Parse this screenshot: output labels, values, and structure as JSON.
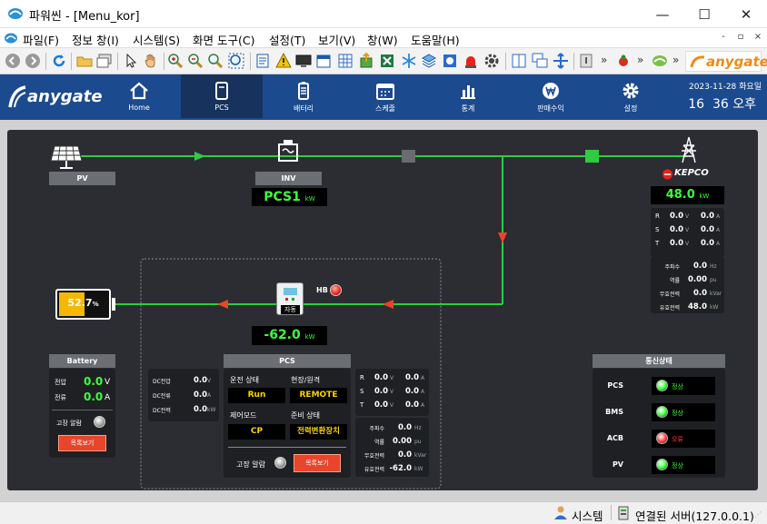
{
  "window": {
    "title": "파워씬 - [Menu_kor]",
    "minimize": "—",
    "maximize": "☐",
    "close": "✕"
  },
  "menubar": {
    "items": [
      "파일(F)",
      "정보 창(I)",
      "시스템(S)",
      "화면 도구(C)",
      "설정(T)",
      "보기(V)",
      "창(W)",
      "도움말(H)"
    ],
    "mdi": [
      "-",
      "▫",
      "×"
    ]
  },
  "toolbar": {
    "overflow": "»",
    "logo": "anygate"
  },
  "header": {
    "logo": "anygate",
    "tabs": [
      {
        "label": "Home",
        "icon": "home-icon"
      },
      {
        "label": "PCS",
        "icon": "phone-icon"
      },
      {
        "label": "배터리",
        "icon": "battery-icon"
      },
      {
        "label": "스케줄",
        "icon": "calendar-icon"
      },
      {
        "label": "통계",
        "icon": "bar-chart-icon"
      },
      {
        "label": "판매수익",
        "icon": "won-icon"
      },
      {
        "label": "설정",
        "icon": "gear-icon"
      }
    ],
    "active_tab": "PCS",
    "date": "2023-11-28 화요일",
    "time": "16  36 오후"
  },
  "diagram": {
    "pv_label": "PV",
    "inv_label": "INV",
    "inv_value": "PCS1",
    "inv_unit": "kW",
    "kepco_logo": "KEPCO",
    "grid_power": "48.0",
    "grid_unit": "kW",
    "battery_soc": "52.7",
    "battery_soc_unit": "%",
    "battery_soc_fraction": 0.527,
    "hb_label": "HB",
    "pcs_mode_badge": "자동",
    "pcs_power": "-62.0",
    "pcs_power_unit": "kW"
  },
  "grid_meter": {
    "rows": [
      {
        "phase": "R",
        "v": "0.0",
        "a": "0.0"
      },
      {
        "phase": "S",
        "v": "0.0",
        "a": "0.0"
      },
      {
        "phase": "T",
        "v": "0.0",
        "a": "0.0"
      }
    ],
    "v_unit": "V",
    "a_unit": "A",
    "freq_label": "주파수",
    "freq": "0.0",
    "freq_unit": "Hz",
    "pf_label": "역률",
    "pf": "0.00",
    "pf_unit": "pu",
    "reactive_label": "무효전력",
    "reactive": "0.0",
    "reactive_unit": "kVar",
    "active_label": "유효전력",
    "active": "48.0",
    "active_unit": "kW"
  },
  "battery_panel": {
    "title": "Battery",
    "voltage_label": "전압",
    "voltage": "0.0",
    "voltage_unit": "V",
    "current_label": "전류",
    "current": "0.0",
    "current_unit": "A",
    "fault_label": "고장 알람",
    "list_button": "목록보기"
  },
  "dc_panel": {
    "rows": [
      {
        "label": "DC전압",
        "value": "0.0",
        "unit": "V"
      },
      {
        "label": "DC전류",
        "value": "0.0",
        "unit": "A"
      },
      {
        "label": "DC전력",
        "value": "0.0",
        "unit": "kW"
      }
    ]
  },
  "pcs_panel": {
    "title": "PCS",
    "run_state_label": "운전 상태",
    "run_state": "Run",
    "local_remote_label": "현장/원격",
    "local_remote": "REMOTE",
    "control_mode_label": "제어모드",
    "control_mode": "CP",
    "ready_state_label": "준비 상태",
    "ready_state": "전력변환장치",
    "fault_label": "고장 알람",
    "list_button": "목록보기"
  },
  "pcs_meter": {
    "rows": [
      {
        "phase": "R",
        "v": "0.0",
        "a": "0.0"
      },
      {
        "phase": "S",
        "v": "0.0",
        "a": "0.0"
      },
      {
        "phase": "T",
        "v": "0.0",
        "a": "0.0"
      }
    ],
    "v_unit": "V",
    "a_unit": "A",
    "freq_label": "주파수",
    "freq": "0.0",
    "freq_unit": "Hz",
    "pf_label": "역률",
    "pf": "0.00",
    "pf_unit": "pu",
    "reactive_label": "무효전력",
    "reactive": "0.0",
    "reactive_unit": "kVar",
    "active_label": "유효전력",
    "active": "-62.0",
    "active_unit": "kW"
  },
  "comm_panel": {
    "title": "통신상태",
    "rows": [
      {
        "name": "PCS",
        "status": "정상",
        "color": "#3cff3c"
      },
      {
        "name": "BMS",
        "status": "정상",
        "color": "#3cff3c"
      },
      {
        "name": "ACB",
        "status": "오류",
        "color": "#ff3c3c"
      },
      {
        "name": "PV",
        "status": "정상",
        "color": "#3cff3c"
      }
    ]
  },
  "statusbar": {
    "user": "시스템",
    "server": "연결된 서버(127.0.0.1)"
  },
  "colors": {
    "header_bg": "#1c4a8e",
    "flow_line": "#2ecc40",
    "flow_arrow_red": "#e8452a",
    "value_green": "#3cff3c",
    "value_yellow": "#ffd400"
  }
}
